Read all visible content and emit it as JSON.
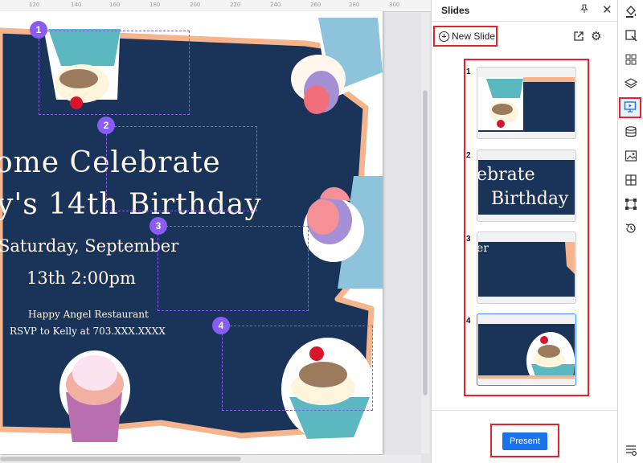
{
  "ruler": {
    "ticks": [
      "120",
      "140",
      "160",
      "180",
      "200",
      "220",
      "240",
      "260",
      "280",
      "300"
    ]
  },
  "slide": {
    "line1": "ome Celebrate",
    "line2": "y's 14th Birthday",
    "line3": "Saturday, September",
    "line4": "13th 2:00pm",
    "line5": "Happy Angel Restaurant",
    "line6": "RSVP to Kelly at 703.XXX.XXXX",
    "badges": [
      "1",
      "2",
      "3",
      "4"
    ],
    "background_color": "#1a3358",
    "frame_color": "#f5b48c"
  },
  "panel": {
    "title": "Slides",
    "pin_icon": "pin-icon",
    "close_icon": "close-icon",
    "new_slide_label": "New Slide",
    "present_label": "Present",
    "thumbnails": [
      {
        "num": "1",
        "text": ""
      },
      {
        "num": "2",
        "text": "ebrate"
      },
      {
        "num": "3",
        "text": "er"
      },
      {
        "num": "4",
        "text": ""
      }
    ],
    "thumbnail2_line2": "Birthday"
  },
  "toolbar": {
    "icons": [
      "fill-icon",
      "edit-shape-icon",
      "grid-icon",
      "layers-icon",
      "presentation-icon",
      "database-icon",
      "image-icon",
      "layout-icon",
      "connector-icon",
      "history-icon",
      "settings-list-icon"
    ]
  },
  "colors": {
    "accent": "#1a73e8",
    "highlight": "#e0262d",
    "selection": "#8a5cf6"
  }
}
